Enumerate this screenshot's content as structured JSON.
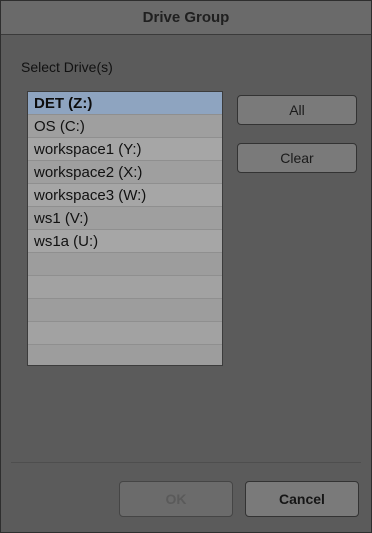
{
  "dialog": {
    "title": "Drive Group",
    "section_label": "Select Drive(s)"
  },
  "drives": [
    {
      "label": "DET (Z:)",
      "selected": true
    },
    {
      "label": "OS (C:)",
      "selected": false
    },
    {
      "label": "workspace1 (Y:)",
      "selected": false
    },
    {
      "label": "workspace2 (X:)",
      "selected": false
    },
    {
      "label": "workspace3 (W:)",
      "selected": false
    },
    {
      "label": "ws1 (V:)",
      "selected": false
    },
    {
      "label": "ws1a (U:)",
      "selected": false
    }
  ],
  "buttons": {
    "all": "All",
    "clear": "Clear",
    "ok": "OK",
    "cancel": "Cancel"
  }
}
